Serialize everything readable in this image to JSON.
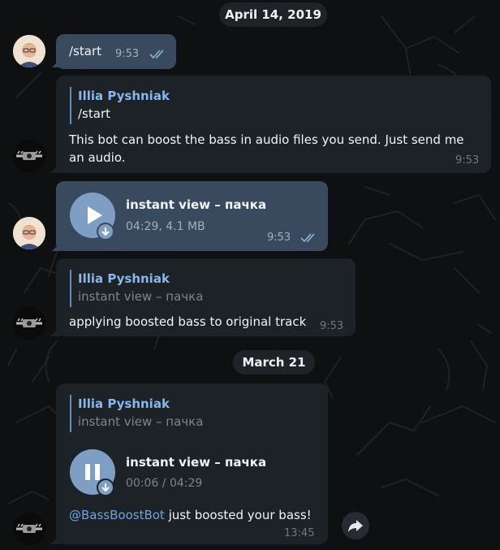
{
  "dates": {
    "first": "April 14, 2019",
    "second": "March 21"
  },
  "messages": {
    "m1": {
      "text": "/start",
      "time": "9:53"
    },
    "m2": {
      "reply_name": "Illia Pyshniak",
      "reply_text": "/start",
      "text": "This bot can boost the bass in audio files you send. Just send me an audio.",
      "time": "9:53"
    },
    "m3": {
      "title": "instant view – пачка",
      "meta": "04:29, 4.1 MB",
      "time": "9:53"
    },
    "m4": {
      "reply_name": "Illia Pyshniak",
      "reply_text": "instant view – пачка",
      "text": "applying boosted bass to original track",
      "time": "9:53"
    },
    "m5": {
      "reply_name": "Illia Pyshniak",
      "reply_text": "instant view – пачка",
      "title": "instant view – пачка",
      "meta": "00:06 / 04:29",
      "mention": "@BassBoostBot",
      "text": " just boosted your bass!",
      "time": "13:45"
    }
  },
  "icons": {
    "play": "play-icon",
    "pause": "pause-icon",
    "download": "download-arrow-icon",
    "share": "share-arrow-icon",
    "read": "double-check-icon"
  },
  "colors": {
    "outgoing_bubble": "#3a4a5e",
    "incoming_bubble": "#1d2227",
    "accent": "#7e9fc3",
    "link": "#6ea3e0"
  }
}
